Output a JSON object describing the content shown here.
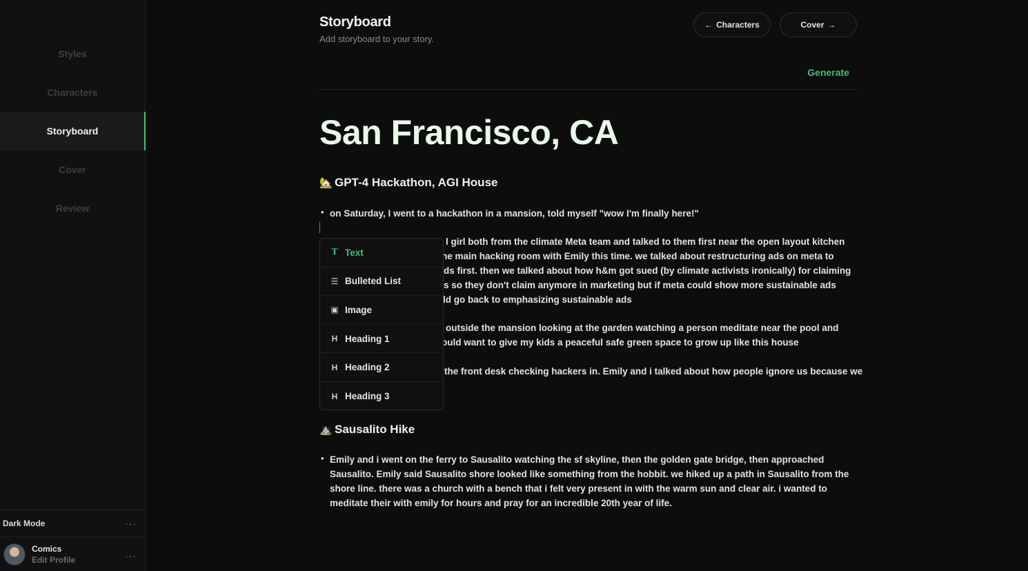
{
  "sidebar": {
    "items": [
      {
        "label": "Styles",
        "active": false
      },
      {
        "label": "Characters",
        "active": false
      },
      {
        "label": "Storyboard",
        "active": true
      },
      {
        "label": "Cover",
        "active": false
      },
      {
        "label": "Review",
        "active": false
      }
    ],
    "dark_mode_label": "Dark Mode",
    "profile": {
      "name": "Comics",
      "sub": "Edit Profile"
    },
    "more_glyph": "···"
  },
  "header": {
    "title": "Storyboard",
    "subtitle": "Add storyboard to your story.",
    "back_label": "Characters",
    "next_label": "Cover",
    "generate_label": "Generate"
  },
  "doc": {
    "title": "San Francisco, CA",
    "sections": [
      {
        "emoji": "🏡",
        "heading": "GPT-4 Hackathon, AGI House",
        "first_bullet": "on Saturday, I went to a hackathon in a mansion, told myself \"wow I'm finally here!\"",
        "partial_lines": [
          "l girl both from the climate Meta team and talked to them first near the open layout kitchen",
          "ne main hacking room with Emily this time. we talked about restructuring ads on meta to",
          "ds first. then we talked about how h&m got sued (by climate activists ironically) for claiming",
          "s so they don't claim anymore in marketing but if meta could show more sustainable ads",
          "ld go back to emphasizing sustainable ads",
          "outside the mansion looking at the garden watching a person meditate near the pool and",
          "ould want to give my kids a peaceful safe green space to grow up like this house",
          "the front desk checking hackers in. Emily and i talked about how people ignore us because we"
        ]
      },
      {
        "emoji": "⛰️",
        "heading": "Sausalito Hike",
        "bullet_lines": [
          "Emily and i went on the ferry to Sausalito watching the sf skyline, then the golden gate bridge, then approached",
          "Sausalito. Emily said Sausalito shore looked like something from the hobbit. we hiked up a path in Sausalito from the",
          "shore line. there was a church with a bench that i felt very present in with the warm sun and clear air. i wanted to",
          "meditate their with emily for hours and pray for an incredible 20th year of life."
        ]
      }
    ]
  },
  "slash_menu": {
    "items": [
      {
        "label": "Text",
        "icon": "T",
        "icon_name": "text-icon",
        "selected": true
      },
      {
        "label": "Bulleted List",
        "icon": "☰",
        "icon_name": "list-icon",
        "selected": false
      },
      {
        "label": "Image",
        "icon": "▣",
        "icon_name": "image-icon",
        "selected": false
      },
      {
        "label": "Heading 1",
        "icon": "H",
        "icon_name": "heading-icon",
        "selected": false
      },
      {
        "label": "Heading 2",
        "icon": "H",
        "icon_name": "heading-icon",
        "selected": false
      },
      {
        "label": "Heading 3",
        "icon": "H",
        "icon_name": "heading-icon",
        "selected": false
      }
    ]
  },
  "colors": {
    "accent": "#43c07a",
    "background": "#0c0d0c",
    "sidebar": "#101110"
  }
}
